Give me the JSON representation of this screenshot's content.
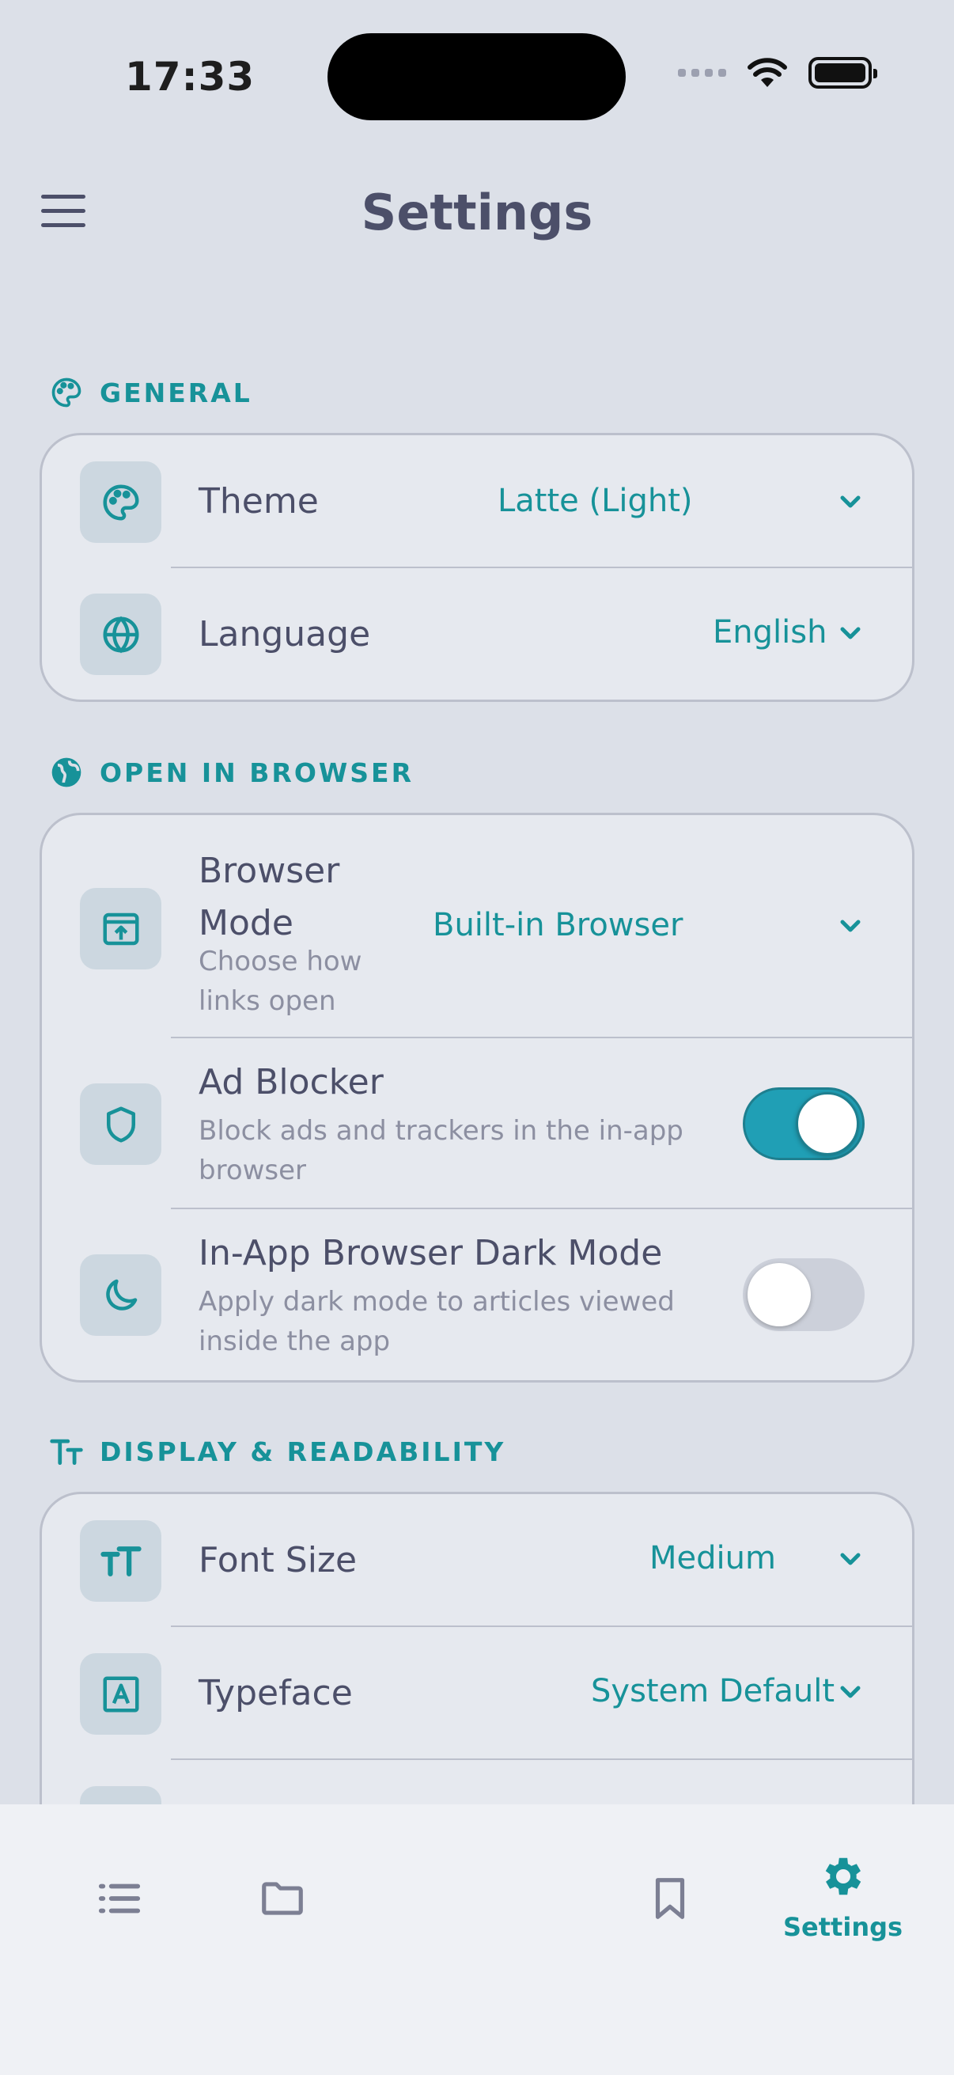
{
  "status_bar": {
    "time": "17:33"
  },
  "header": {
    "title": "Settings"
  },
  "sections": {
    "general": {
      "label": "GENERAL",
      "theme": {
        "title": "Theme",
        "value": "Latte (Light)"
      },
      "language": {
        "title": "Language",
        "value": "English"
      }
    },
    "browser": {
      "label": "OPEN IN BROWSER",
      "browser_mode": {
        "title_line1": "Browser",
        "title_line2": "Mode",
        "sub_line1": "Choose how",
        "sub_line2": "links open",
        "value": "Built-in Browser"
      },
      "ad_blocker": {
        "title": "Ad Blocker",
        "sub_line1": "Block ads and trackers in the in-app",
        "sub_line2": "browser",
        "enabled": true
      },
      "dark_mode": {
        "title": "In-App Browser Dark Mode",
        "sub_line1": "Apply dark mode to articles viewed",
        "sub_line2": "inside the app",
        "enabled": false
      }
    },
    "display": {
      "label": "DISPLAY & READABILITY",
      "font_size": {
        "title": "Font Size",
        "value": "Medium"
      },
      "typeface": {
        "title": "Typeface",
        "value": "System Default"
      }
    }
  },
  "tabbar": {
    "items": [
      {
        "icon": "list-icon"
      },
      {
        "icon": "folder-icon"
      },
      {
        "icon": "bookmark-icon"
      },
      {
        "icon": "gear-icon",
        "label": "Settings",
        "active": true
      }
    ]
  },
  "colors": {
    "accent": "#179299",
    "toggle_on": "#209fb5",
    "background": "#dce0e8"
  }
}
